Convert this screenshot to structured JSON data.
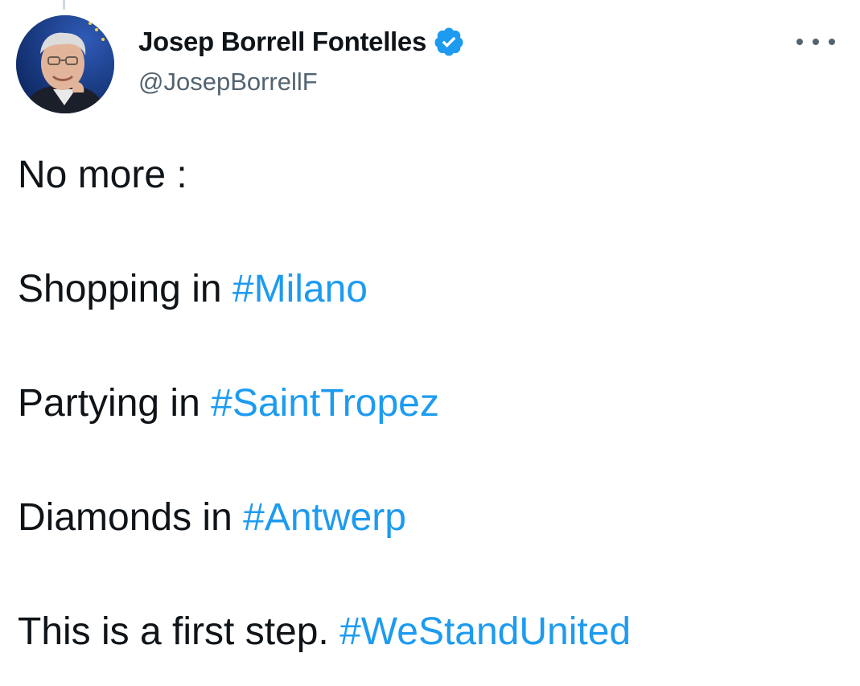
{
  "author": {
    "name": "Josep Borrell Fontelles",
    "handle": "@JosepBorrellF",
    "verified_icon": "verified-badge-icon",
    "avatar": "profile-photo"
  },
  "menu": {
    "icon": "more-options-icon"
  },
  "tweet": {
    "lines": [
      {
        "text": "No more :",
        "hashtag": ""
      },
      {
        "text": "Shopping in ",
        "hashtag": "#Milano"
      },
      {
        "text": "Partying in ",
        "hashtag": "#SaintTropez"
      },
      {
        "text": "Diamonds in ",
        "hashtag": "#Antwerp"
      },
      {
        "text": "This is a first step. ",
        "hashtag": "#WeStandUnited"
      }
    ]
  },
  "colors": {
    "hashtag": "#1d9bf0",
    "text": "#0f1419",
    "handle": "#536471",
    "verified": "#1d9bf0"
  }
}
